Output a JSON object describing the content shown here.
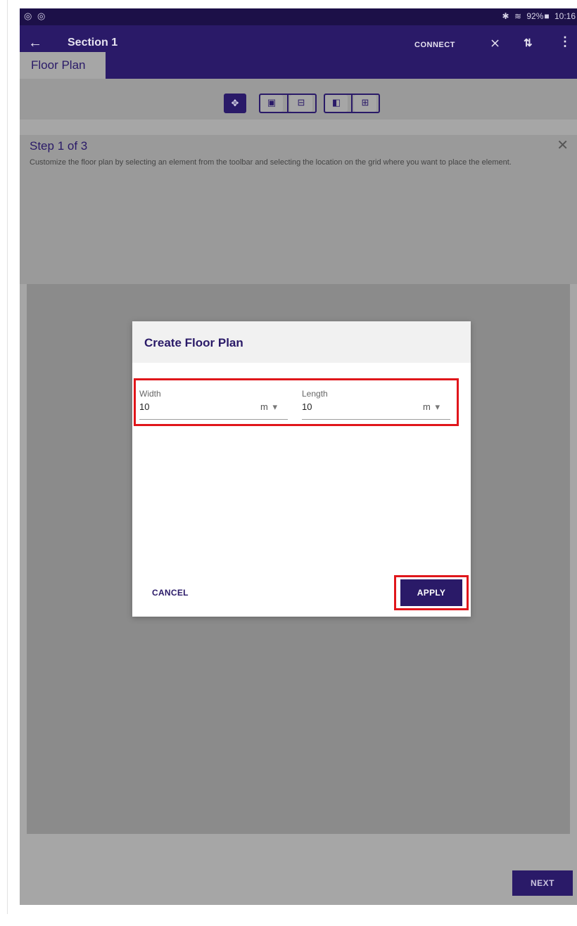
{
  "status_bar": {
    "left_icons": "◎ ◎",
    "bluetooth": "✱",
    "wifi": "≋",
    "battery": "92%",
    "battery_icon": "■",
    "time": "10:16"
  },
  "app_bar": {
    "back_icon": "←",
    "title": "Section 1",
    "connect_label": "CONNECT",
    "signal_icon": "⨯",
    "sort_icon": "⇅",
    "menu_icon": "⋮"
  },
  "tabs": [
    {
      "label": "Floor Plan",
      "selected": true
    }
  ],
  "toolbar": {
    "move_icon": "✥",
    "room_add_icon": "▣",
    "room_remove_icon": "⊟",
    "door_icon": "◧",
    "window_icon": "⊞"
  },
  "step": {
    "title": "Step 1 of 3",
    "description": "Customize the floor plan by selecting an element from the toolbar and selecting the location on the grid where you want to place the element.",
    "close_icon": "✕"
  },
  "dialog": {
    "title": "Create Floor Plan",
    "width": {
      "label": "Width",
      "value": "10",
      "unit": "m"
    },
    "length": {
      "label": "Length",
      "value": "10",
      "unit": "m"
    },
    "dropdown_icon": "▾",
    "cancel_label": "CANCEL",
    "apply_label": "APPLY"
  },
  "footer": {
    "next_label": "NEXT"
  },
  "colors": {
    "primary": "#2a1a68",
    "status_bar": "#1c1048",
    "highlight": "#e0161b",
    "overlay": "#8b8b8b"
  }
}
